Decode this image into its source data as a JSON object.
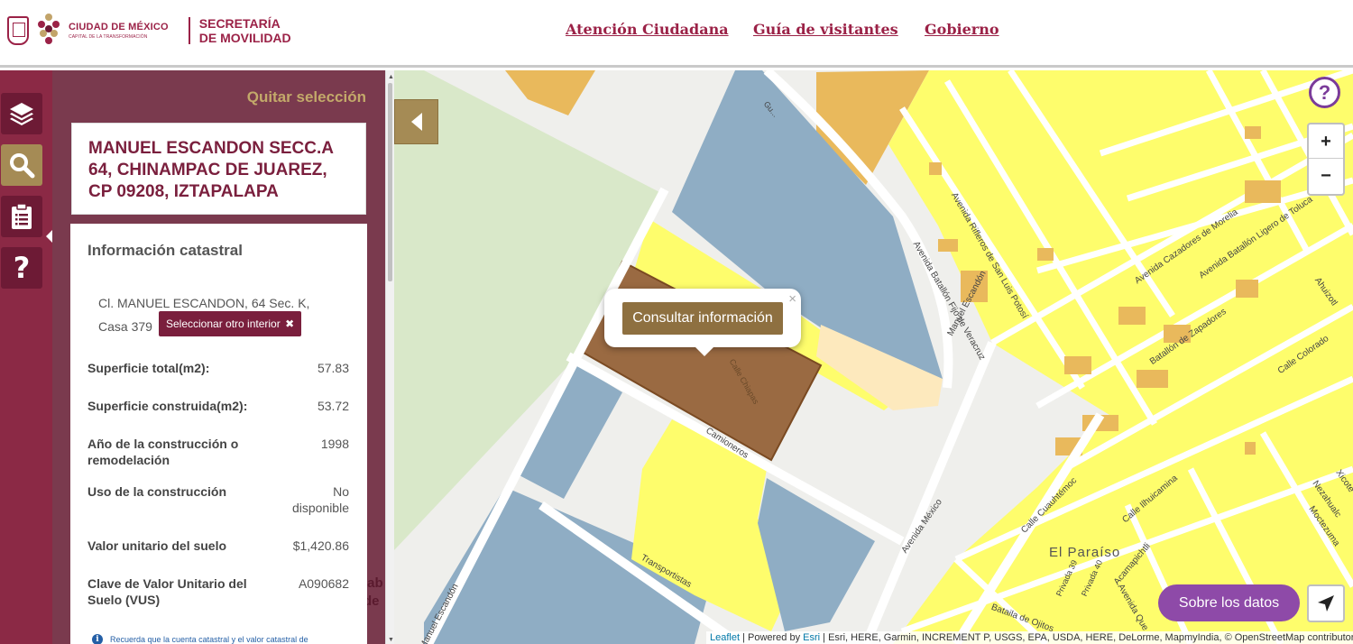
{
  "header": {
    "logo_line1": "CIUDAD DE MÉXICO",
    "logo_line2": "CAPITAL DE LA TRANSFORMACIÓN",
    "secretaria_line1": "SECRETARÍA",
    "secretaria_line2": "DE MOVILIDAD",
    "nav": [
      "Atención Ciudadana",
      "Guía de visitantes",
      "Gobierno"
    ]
  },
  "rail": {
    "buttons": [
      "layers-icon",
      "search-icon",
      "clipboard-icon",
      "question-icon"
    ],
    "active": "search-icon"
  },
  "panel": {
    "quitar_label": "Quitar selección",
    "address": "MANUEL ESCANDON SECC.A 64, CHINAMPAC DE JUAREZ, CP 09208, IZTAPALAPA",
    "info_title": "Información catastral",
    "info_address_line1": "Cl. MANUEL ESCANDON, 64 Sec. K,",
    "info_address_line2": "Casa 379",
    "select_other_label": "Seleccionar otro interior",
    "rows": [
      {
        "label": "Superficie total(m2):",
        "value": "57.83"
      },
      {
        "label": "Superficie construida(m2):",
        "value": "53.72"
      },
      {
        "label": "Año de la construcción o remodelación",
        "value": "1998"
      },
      {
        "label": "Uso de la construcción",
        "value": "No disponible"
      },
      {
        "label": "Valor unitario del suelo",
        "value": "$1,420.86"
      },
      {
        "label": "Clave de Valor Unitario del Suelo (VUS)",
        "value": "A090682"
      }
    ],
    "note": "Recuerda que la cuenta catastral y el valor catastral de",
    "behind_text": [
      "lab",
      "de",
      ":"
    ]
  },
  "map": {
    "popup_button": "Consultar información",
    "popup_close": "×",
    "help": "?",
    "zoom_in": "+",
    "zoom_out": "−",
    "sobre_label": "Sobre los datos",
    "place_label": "El Paraíso",
    "street_labels": [
      "Manuel Escandón",
      "Camioneros",
      "Transportistas",
      "Avenida México",
      "Calle Cuauhtémoc",
      "Calle Ilhuicamina",
      "Acamapichtli",
      "Avenida Que",
      "Bataila de Ojitos",
      "Avenida Batallón Fijo de Veracruz",
      "Avenida Rifleros de San Luis Potosí",
      "Avenida Cazadores de Morelia",
      "Avenida Batallón Ligero de Toluca",
      "Batallón de Zapadores",
      "Calle Colorado",
      "Privada 39",
      "Privada 40",
      "Ahuizotl",
      "Nezahualc",
      "Xicote",
      "Moctezuma",
      "Calle Chiapas",
      "Gu..."
    ],
    "colors": {
      "yellow": "#fefd6c",
      "blue": "#8fadc4",
      "orange": "#e9b95c",
      "green": "#d9e8c9",
      "selected": "#9a6a42"
    }
  },
  "attribution": {
    "leaflet": "Leaflet",
    "powered": " | Powered by ",
    "esri": "Esri",
    "rest": " | Esri, HERE, Garmin, INCREMENT P, USGS, EPA, USDA, HERE, DeLorme, MapmyIndia, © OpenStreetMap contributors"
  }
}
